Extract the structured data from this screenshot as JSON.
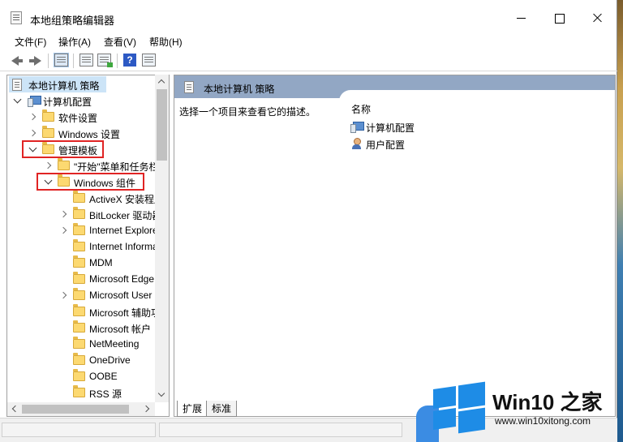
{
  "window": {
    "title": "本地组策略编辑器"
  },
  "menu": [
    "文件(F)",
    "操作(A)",
    "查看(V)",
    "帮助(H)"
  ],
  "toolbar": {
    "icons": [
      "back-arrow-icon",
      "forward-arrow-icon",
      "show-hide-tree-icon",
      "properties-icon",
      "export-list-icon",
      "help-icon",
      "filter-options-icon"
    ],
    "help_glyph": "?"
  },
  "tree": {
    "root": "本地计算机 策略",
    "computer_config": "计算机配置",
    "software_settings": "软件设置",
    "windows_settings": "Windows 设置",
    "admin_templates": "管理模板",
    "start_menu": "\"开始\"菜单和任务栏",
    "windows_components": "Windows 组件",
    "components": [
      {
        "label": "ActiveX 安装程序服务",
        "expandable": false
      },
      {
        "label": "BitLocker 驱动器加密",
        "expandable": true
      },
      {
        "label": "Internet Explorer",
        "expandable": true
      },
      {
        "label": "Internet Information Services",
        "expandable": false
      },
      {
        "label": "MDM",
        "expandable": false
      },
      {
        "label": "Microsoft Edge",
        "expandable": false
      },
      {
        "label": "Microsoft User Experience Virtualization",
        "expandable": true
      },
      {
        "label": "Microsoft 辅助功能",
        "expandable": false
      },
      {
        "label": "Microsoft 帐户",
        "expandable": false
      },
      {
        "label": "NetMeeting",
        "expandable": false
      },
      {
        "label": "OneDrive",
        "expandable": false
      },
      {
        "label": "OOBE",
        "expandable": false
      },
      {
        "label": "RSS 源",
        "expandable": false
      }
    ]
  },
  "right": {
    "header": "本地计算机 策略",
    "description": "选择一个项目来查看它的描述。",
    "column_name": "名称",
    "items": [
      "计算机配置",
      "用户配置"
    ]
  },
  "tabs": [
    "扩展",
    "标准"
  ],
  "watermark": {
    "title": "Win10 之家",
    "url": "www.win10xitong.com"
  },
  "colors": {
    "selection": "#cce4f7",
    "highlight_border": "#e02424",
    "header_band": "#92a7c4",
    "brand_blue": "#1e8ce6"
  }
}
